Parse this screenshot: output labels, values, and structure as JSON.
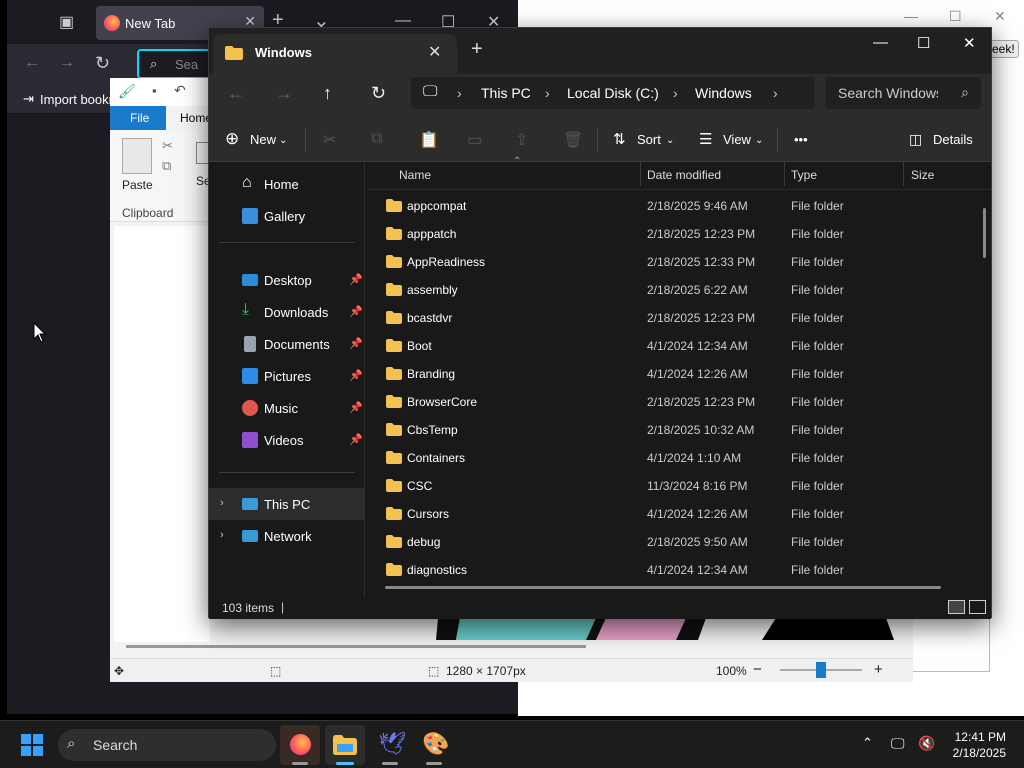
{
  "bg_window": {
    "control_min": "—",
    "control_max": "☐",
    "control_close": "✕",
    "partial_text": "eek!"
  },
  "firefox": {
    "tab_title": "New Tab",
    "tab_close": "✕",
    "new_tab": "+",
    "tab_list": "⌄",
    "win_min": "—",
    "win_max": "☐",
    "win_close": "✕",
    "nav_back": "←",
    "nav_forward": "→",
    "nav_reload": "↻",
    "url_placeholder": "Sea",
    "bookmark_label": "Import bookn"
  },
  "paint": {
    "file_tab": "File",
    "home_tab": "Home",
    "paste_label": "Paste",
    "select_label": "Se",
    "clipboard_group": "Clipboard",
    "status_dims": "1280 × 1707px",
    "zoom": "100%",
    "zoom_minus": "−",
    "zoom_plus": "+"
  },
  "explorer": {
    "tab_title": "Windows",
    "tab_close": "✕",
    "new_tab": "+",
    "win_min": "—",
    "win_max": "☐",
    "win_close": "✕",
    "nav_back": "←",
    "nav_forward": "→",
    "nav_up": "↑",
    "nav_refresh": "↻",
    "breadcrumb": [
      "This PC",
      "Local Disk (C:)",
      "Windows"
    ],
    "search_placeholder": "Search Windows",
    "toolbar": {
      "new": "New",
      "sort": "Sort",
      "view": "View",
      "more": "•••",
      "details": "Details"
    },
    "nav": {
      "home": "Home",
      "gallery": "Gallery",
      "desktop": "Desktop",
      "downloads": "Downloads",
      "documents": "Documents",
      "pictures": "Pictures",
      "music": "Music",
      "videos": "Videos",
      "this_pc": "This PC",
      "network": "Network"
    },
    "columns": {
      "name": "Name",
      "date": "Date modified",
      "type": "Type",
      "size": "Size"
    },
    "rows": [
      {
        "name": "appcompat",
        "date": "2/18/2025 9:46 AM",
        "type": "File folder"
      },
      {
        "name": "apppatch",
        "date": "2/18/2025 12:23 PM",
        "type": "File folder"
      },
      {
        "name": "AppReadiness",
        "date": "2/18/2025 12:33 PM",
        "type": "File folder"
      },
      {
        "name": "assembly",
        "date": "2/18/2025 6:22 AM",
        "type": "File folder"
      },
      {
        "name": "bcastdvr",
        "date": "2/18/2025 12:23 PM",
        "type": "File folder"
      },
      {
        "name": "Boot",
        "date": "4/1/2024 12:34 AM",
        "type": "File folder"
      },
      {
        "name": "Branding",
        "date": "4/1/2024 12:26 AM",
        "type": "File folder"
      },
      {
        "name": "BrowserCore",
        "date": "2/18/2025 12:23 PM",
        "type": "File folder"
      },
      {
        "name": "CbsTemp",
        "date": "2/18/2025 10:32 AM",
        "type": "File folder"
      },
      {
        "name": "Containers",
        "date": "4/1/2024 1:10 AM",
        "type": "File folder"
      },
      {
        "name": "CSC",
        "date": "11/3/2024 8:16 PM",
        "type": "File folder"
      },
      {
        "name": "Cursors",
        "date": "4/1/2024 12:26 AM",
        "type": "File folder"
      },
      {
        "name": "debug",
        "date": "2/18/2025 9:50 AM",
        "type": "File folder"
      },
      {
        "name": "diagnostics",
        "date": "4/1/2024 12:34 AM",
        "type": "File folder"
      }
    ],
    "status_count": "103 items"
  },
  "taskbar": {
    "search_label": "Search",
    "time": "12:41 PM",
    "date": "2/18/2025"
  },
  "colors": {
    "folder": "#f2c14e",
    "accent": "#0078d4",
    "explorer_bg": "#191919"
  }
}
